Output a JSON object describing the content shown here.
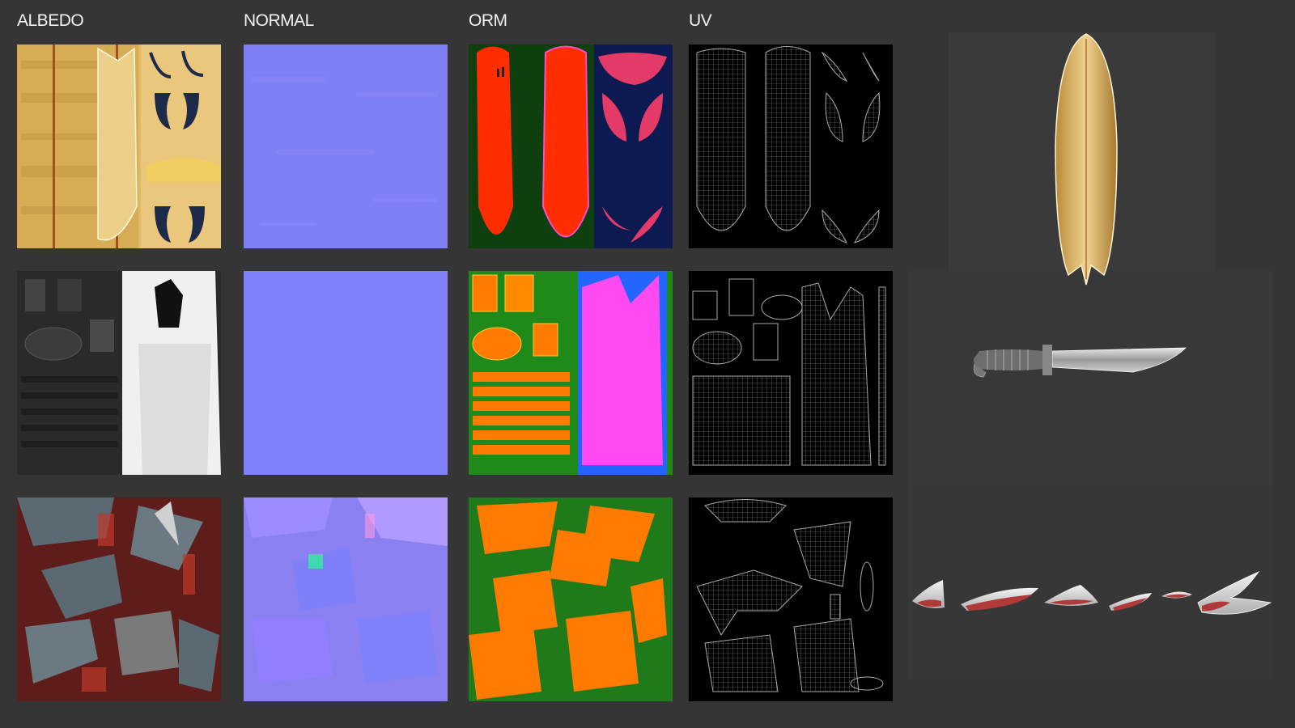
{
  "headers": {
    "albedo": "ALBEDO",
    "normal": "NORMAL",
    "orm": "ORM",
    "uv": "UV"
  },
  "colors": {
    "background": "#353535",
    "normal_base": "#7f80f8",
    "orm_red": "#ff2a00",
    "orm_orange": "#ff7a00",
    "orm_green": "#1f7a1a",
    "orm_magenta": "#ff4af2",
    "uv_wire": "#9a9a9a",
    "surfboard_wood": "#e8c070"
  },
  "rows": [
    {
      "asset": "surfboard",
      "maps": [
        "albedo-texture",
        "normal-map",
        "orm-map",
        "uv-layout"
      ]
    },
    {
      "asset": "knife",
      "maps": [
        "albedo-texture",
        "normal-map",
        "orm-map",
        "uv-layout"
      ]
    },
    {
      "asset": "shell-pieces",
      "maps": [
        "albedo-texture",
        "normal-map",
        "orm-map",
        "uv-layout"
      ]
    }
  ]
}
